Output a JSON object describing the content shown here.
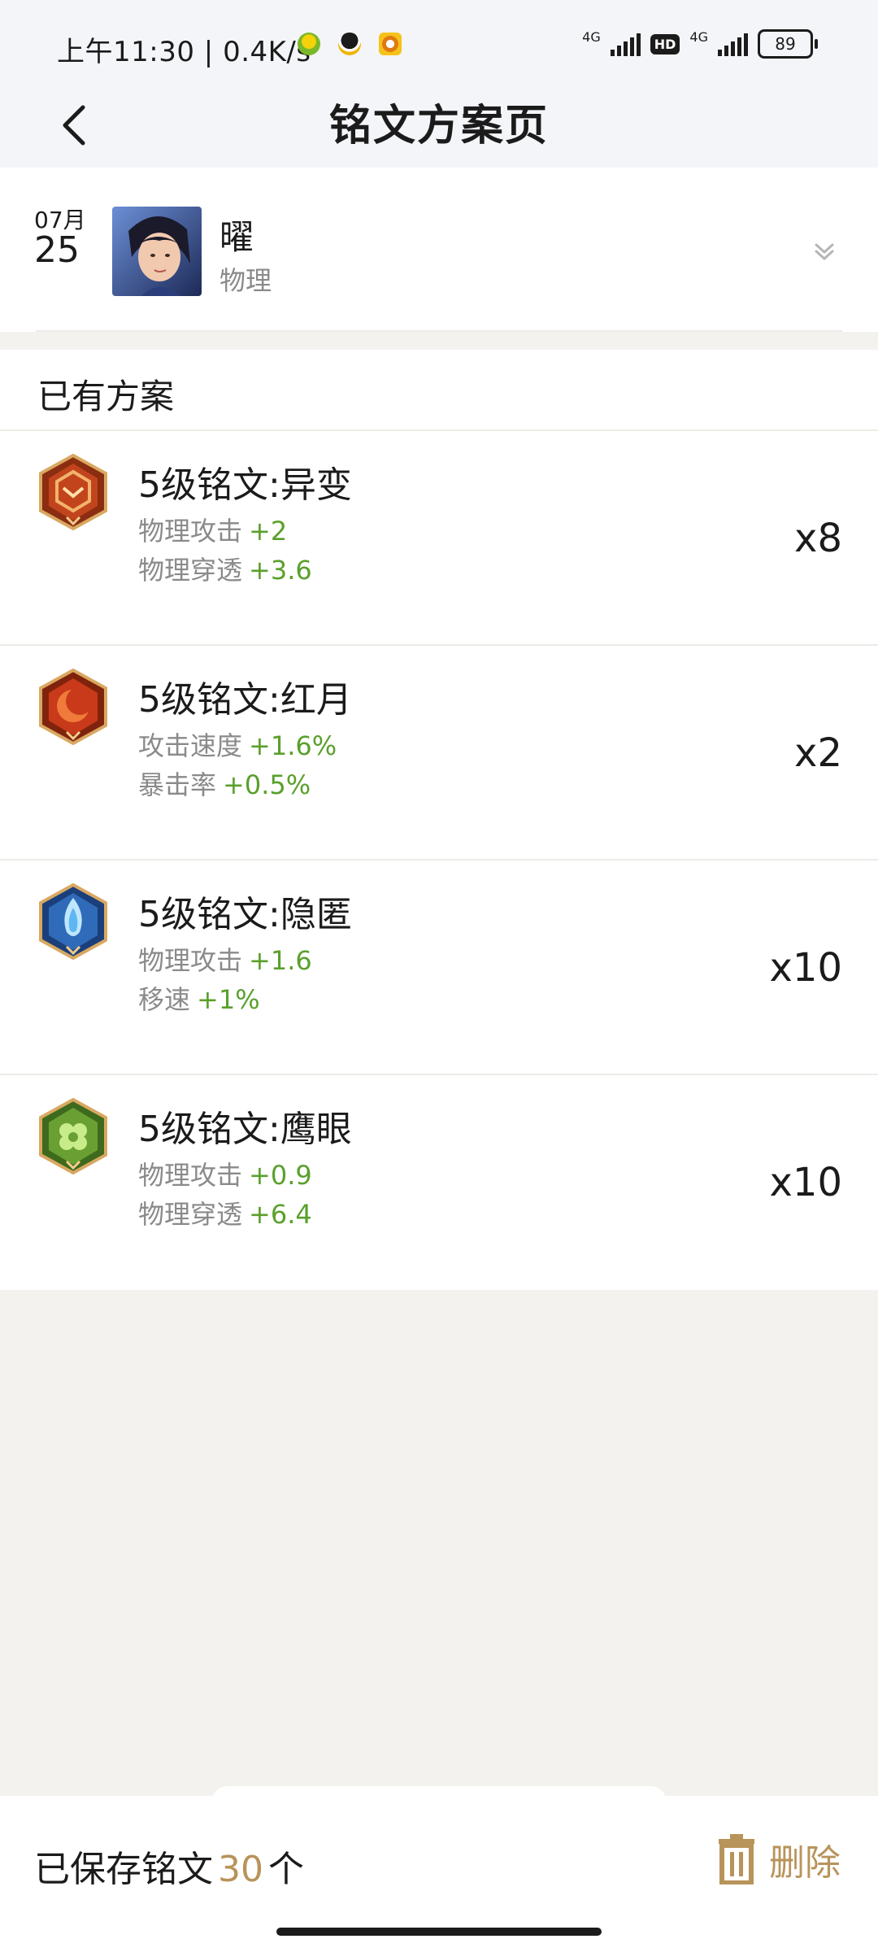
{
  "status_bar": {
    "time": "上午11:30",
    "speed": "0.4K/s",
    "network1": "4G",
    "hd": "HD",
    "network2": "4G",
    "battery": "89"
  },
  "header": {
    "title": "铭文方案页"
  },
  "hero": {
    "month": "07月",
    "day": "25",
    "name": "曜",
    "type": "物理"
  },
  "section": {
    "title": "已有方案"
  },
  "runes": [
    {
      "name": "5级铭文:异变",
      "icon": "rune-variant-icon",
      "color": "#c2441d",
      "stats": [
        {
          "label": "物理攻击",
          "value": "+2"
        },
        {
          "label": "物理穿透",
          "value": "+3.6"
        }
      ],
      "count": "x8"
    },
    {
      "name": "5级铭文:红月",
      "icon": "rune-redmoon-icon",
      "color": "#c93a1a",
      "stats": [
        {
          "label": "攻击速度",
          "value": "+1.6%"
        },
        {
          "label": "暴击率",
          "value": "+0.5%"
        }
      ],
      "count": "x2"
    },
    {
      "name": "5级铭文:隐匿",
      "icon": "rune-stealth-icon",
      "color": "#2f6bb8",
      "stats": [
        {
          "label": "物理攻击",
          "value": "+1.6"
        },
        {
          "label": "移速",
          "value": "+1%"
        }
      ],
      "count": "x10"
    },
    {
      "name": "5级铭文:鹰眼",
      "icon": "rune-hawkeye-icon",
      "color": "#6aa033",
      "stats": [
        {
          "label": "物理攻击",
          "value": "+0.9"
        },
        {
          "label": "物理穿透",
          "value": "+6.4"
        }
      ],
      "count": "x10"
    }
  ],
  "footer": {
    "saved_prefix": "已保存铭文",
    "saved_count": "30",
    "saved_suffix": "个",
    "delete_label": "删除",
    "accent": "#b8935a"
  }
}
